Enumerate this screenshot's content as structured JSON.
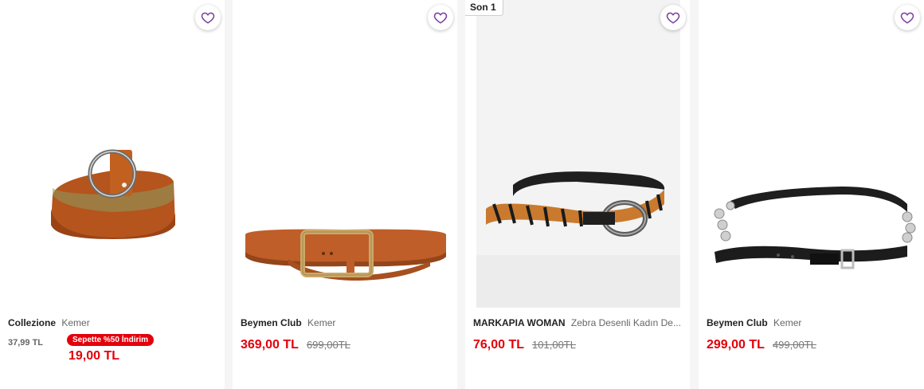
{
  "colors": {
    "accent": "#e3000b",
    "wishlist": "#7b3fa0",
    "page_bg": "#f5f5f5"
  },
  "products": [
    {
      "brand": "Collezione",
      "name": "Kemer",
      "original_price": "37,99 TL",
      "promo_label": "Sepette %50 İndirim",
      "basket_price": "19,00 TL",
      "icon": "heart-outline-icon"
    },
    {
      "brand": "Beymen Club",
      "name": "Kemer",
      "price": "369,00 TL",
      "old_price": "699,00TL",
      "icon": "heart-outline-icon"
    },
    {
      "badge": "Son 1",
      "brand": "MARKAPIA WOMAN",
      "name": "Zebra Desenli Kadın De...",
      "price": "76,00 TL",
      "old_price": "101,00TL",
      "icon": "heart-outline-icon"
    },
    {
      "brand": "Beymen Club",
      "name": "Kemer",
      "price": "299,00 TL",
      "old_price": "499,00TL",
      "icon": "heart-outline-icon"
    }
  ]
}
